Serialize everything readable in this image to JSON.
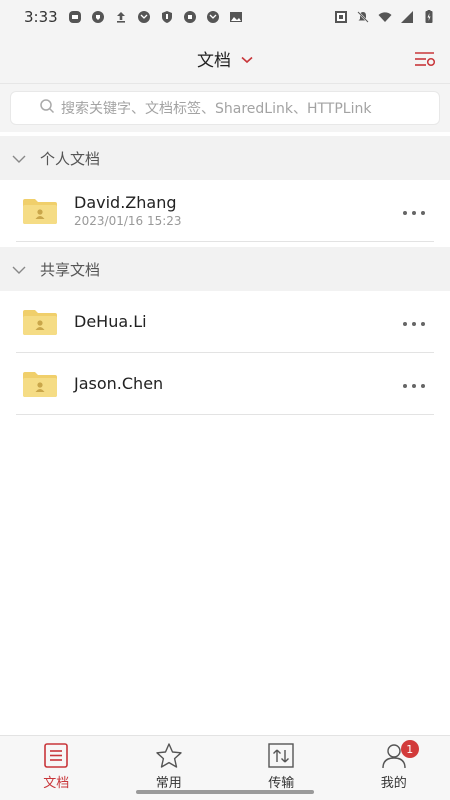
{
  "status_bar": {
    "time": "3:33"
  },
  "header": {
    "title": "文档"
  },
  "search": {
    "placeholder": "搜索关键字、文档标签、SharedLink、HTTPLink"
  },
  "sections": [
    {
      "title": "个人文档",
      "items": [
        {
          "name": "David.Zhang",
          "date": "2023/01/16  15:23"
        }
      ]
    },
    {
      "title": "共享文档",
      "items": [
        {
          "name": "DeHua.Li"
        },
        {
          "name": "Jason.Chen"
        }
      ]
    }
  ],
  "bottom_nav": {
    "items": [
      {
        "label": "文档",
        "icon": "document-list-icon",
        "active": true
      },
      {
        "label": "常用",
        "icon": "star-icon"
      },
      {
        "label": "传输",
        "icon": "transfer-icon"
      },
      {
        "label": "我的",
        "icon": "profile-icon",
        "badge": "1"
      }
    ]
  },
  "colors": {
    "accent": "#c8363a",
    "folder": "#f2d97a",
    "badge": "#d23b3b"
  }
}
